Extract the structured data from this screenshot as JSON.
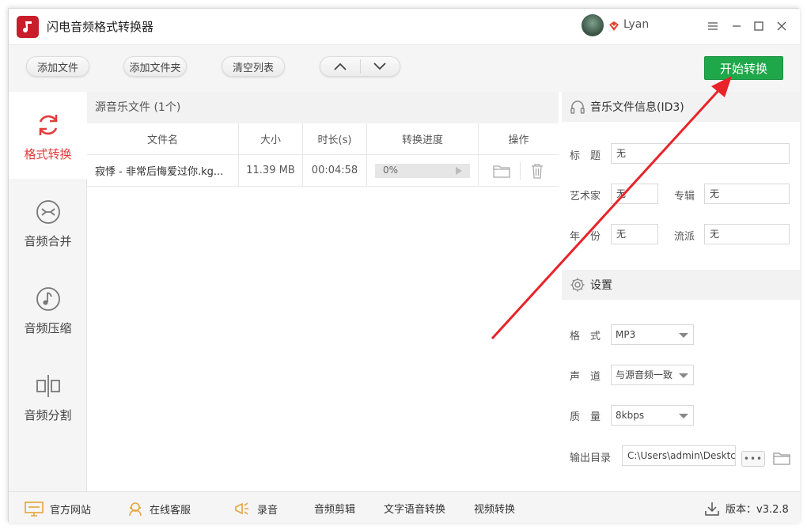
{
  "app": {
    "title": "闪电音频格式转换器"
  },
  "user": {
    "name": "Lyan"
  },
  "toolbar": {
    "add_file": "添加文件",
    "add_folder": "添加文件夹",
    "clear_list": "清空列表",
    "start": "开始转换"
  },
  "sidebar": {
    "items": [
      {
        "label": "格式转换",
        "icon": "refresh-icon",
        "active": true
      },
      {
        "label": "音频合并",
        "icon": "merge-icon"
      },
      {
        "label": "音频压缩",
        "icon": "music-note-icon"
      },
      {
        "label": "音频分割",
        "icon": "split-icon"
      }
    ]
  },
  "file_list": {
    "header": "源音乐文件 (1个)",
    "columns": [
      "文件名",
      "大小",
      "时长(s)",
      "转换进度",
      "操作"
    ],
    "rows": [
      {
        "name": "寂悸 - 非常后悔爱过你.kg...",
        "size": "11.39 MB",
        "duration": "00:04:58",
        "progress": "0%"
      }
    ]
  },
  "id3": {
    "header": "音乐文件信息(ID3)",
    "title_label": "标　题",
    "title_value": "无",
    "artist_label": "艺术家",
    "artist_value": "无",
    "album_label": "专辑",
    "album_value": "无",
    "year_label": "年　份",
    "year_value": "无",
    "genre_label": "流派",
    "genre_value": "无"
  },
  "settings": {
    "header": "设置",
    "format_label": "格　式",
    "format_value": "MP3",
    "channel_label": "声　道",
    "channel_value": "与源音频一致",
    "quality_label": "质　量",
    "quality_value": "8kbps",
    "output_label": "输出目录",
    "output_value": "C:\\Users\\admin\\Desktc",
    "browse_label": "•••"
  },
  "bottom": {
    "website": "官方网站",
    "service": "在线客服",
    "record": "录音",
    "audio_edit": "音频剪辑",
    "tts": "文字语音转换",
    "video_convert": "视频转换",
    "version": "版本：v3.2.8"
  },
  "colors": {
    "accent": "#e43c3c",
    "start_button": "#1fa84a",
    "annotation_arrow": "#e8232a"
  }
}
